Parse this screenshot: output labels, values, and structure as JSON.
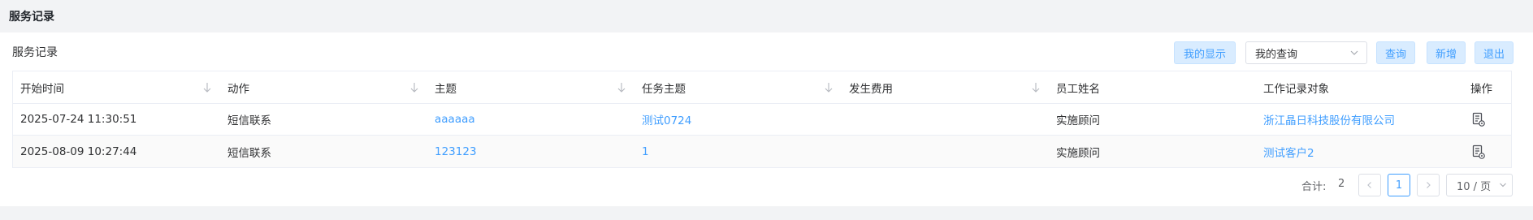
{
  "page": {
    "title": "服务记录"
  },
  "panel": {
    "title": "服务记录",
    "buttons": {
      "my_display": "我的显示",
      "query": "查询",
      "add": "新增",
      "exit": "退出"
    },
    "query_select": {
      "value": "我的查询"
    }
  },
  "table": {
    "columns": [
      "开始时间",
      "动作",
      "主题",
      "任务主题",
      "发生费用",
      "员工姓名",
      "工作记录对象",
      "操作"
    ],
    "rows": [
      {
        "start_time": "2025-07-24 11:30:51",
        "action": "短信联系",
        "subject": "aaaaaa",
        "task_subject": "测试0724",
        "cost": "",
        "employee": "实施顾问",
        "record_object": "浙江晶日科技股份有限公司"
      },
      {
        "start_time": "2025-08-09 10:27:44",
        "action": "短信联系",
        "subject": "123123",
        "task_subject": "1",
        "cost": "",
        "employee": "实施顾问",
        "record_object": "测试客户2"
      }
    ]
  },
  "pagination": {
    "total_label": "合计:",
    "total": "2",
    "current_page": "1",
    "page_size": "10 / 页"
  },
  "icons": {
    "sort": "sort-down-icon",
    "operation": "record-view-icon",
    "prev": "chevron-left-icon",
    "next": "chevron-right-icon"
  },
  "colors": {
    "accent": "#409eff",
    "button_bg": "#d9ecff",
    "background": "#f2f3f5"
  }
}
